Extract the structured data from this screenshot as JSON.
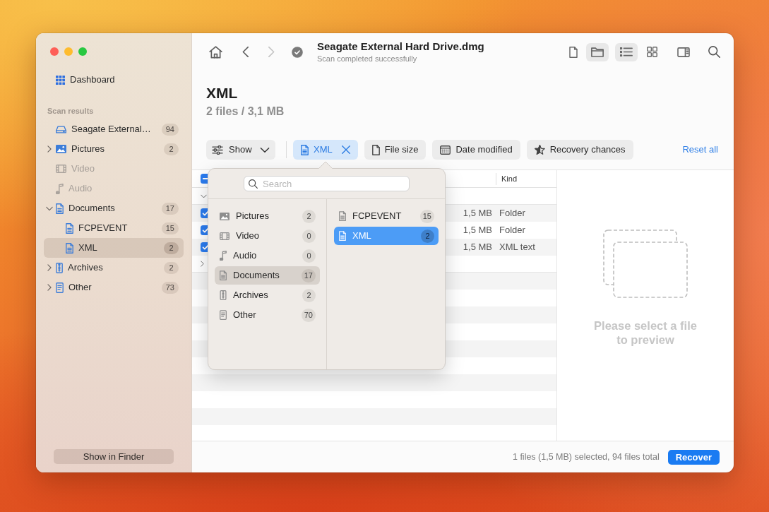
{
  "window": {
    "title": "Seagate External Hard Drive.dmg",
    "subtitle": "Scan completed successfully"
  },
  "sidebar": {
    "dashboard": {
      "label": "Dashboard"
    },
    "section_label": "Scan results",
    "items": [
      {
        "kind": "drive",
        "label": "Seagate External…",
        "count": "94",
        "selected": false,
        "disabled": false
      },
      {
        "kind": "pictures",
        "label": "Pictures",
        "count": "2",
        "expanded": false,
        "selected": false,
        "disabled": false
      },
      {
        "kind": "video",
        "label": "Video",
        "selected": false,
        "disabled": true
      },
      {
        "kind": "audio",
        "label": "Audio",
        "selected": false,
        "disabled": true
      },
      {
        "kind": "documents",
        "label": "Documents",
        "count": "17",
        "expanded": true,
        "selected": false,
        "disabled": false,
        "children": [
          {
            "kind": "document",
            "label": "FCPEVENT",
            "count": "15",
            "selected": false,
            "disabled": false
          },
          {
            "kind": "document",
            "label": "XML",
            "count": "2",
            "selected": true,
            "disabled": false
          }
        ]
      },
      {
        "kind": "archives",
        "label": "Archives",
        "count": "2",
        "expanded": false,
        "selected": false,
        "disabled": false
      },
      {
        "kind": "other",
        "label": "Other",
        "count": "73",
        "expanded": false,
        "selected": false,
        "disabled": false
      }
    ],
    "footer_button": "Show in Finder"
  },
  "toolbar": {
    "nav": [
      {
        "kind": "home",
        "disabled": false
      },
      {
        "kind": "back",
        "disabled": false
      },
      {
        "kind": "forward",
        "disabled": true
      }
    ],
    "source_toggle": [
      {
        "kind": "file",
        "selected": false
      },
      {
        "kind": "folder",
        "selected": true
      }
    ],
    "view_toggle": [
      {
        "kind": "list",
        "selected": true
      },
      {
        "kind": "grid",
        "selected": false
      }
    ]
  },
  "heading": {
    "title": "XML",
    "summary": "2 files / 3,1 MB"
  },
  "filters": {
    "show": "Show",
    "chips": [
      {
        "kind": "document",
        "label": "XML",
        "selected": true
      },
      {
        "kind": "file",
        "label": "File size",
        "selected": false
      },
      {
        "kind": "calendar",
        "label": "Date modified",
        "selected": false
      },
      {
        "kind": "star",
        "label": "Recovery chances",
        "selected": false
      }
    ],
    "reset": "Reset all"
  },
  "table": {
    "columns": [
      "Kind"
    ],
    "select_all": {
      "indeterminate": true
    },
    "rows": [
      {
        "kind": "group",
        "expanded": true
      },
      {
        "kind": "file",
        "checked": true,
        "cells": [
          "1,5 MB",
          "Folder"
        ]
      },
      {
        "kind": "file",
        "checked": true,
        "cells": [
          "1,5 MB",
          "Folder"
        ]
      },
      {
        "kind": "file",
        "checked": true,
        "cells": [
          "1,5 MB",
          "XML text"
        ]
      },
      {
        "kind": "group",
        "expanded": false
      }
    ]
  },
  "popover": {
    "search": {
      "placeholder": "Search"
    },
    "categories": [
      {
        "kind": "pictures",
        "label": "Pictures",
        "count": "2",
        "selected": false
      },
      {
        "kind": "video",
        "label": "Video",
        "count": "0",
        "selected": false
      },
      {
        "kind": "audio",
        "label": "Audio",
        "count": "0",
        "selected": false
      },
      {
        "kind": "documents",
        "label": "Documents",
        "count": "17",
        "selected": true
      },
      {
        "kind": "archives",
        "label": "Archives",
        "count": "2",
        "selected": false
      },
      {
        "kind": "other",
        "label": "Other",
        "count": "70",
        "selected": false
      }
    ],
    "subcategories": [
      {
        "kind": "document",
        "label": "FCPEVENT",
        "count": "15",
        "selected": false
      },
      {
        "kind": "document",
        "label": "XML",
        "count": "2",
        "selected": true
      }
    ]
  },
  "preview": {
    "message": "Please select a file to preview"
  },
  "status_bar": {
    "text": "1 files (1,5 MB) selected, 94 files total",
    "button": "Recover"
  }
}
